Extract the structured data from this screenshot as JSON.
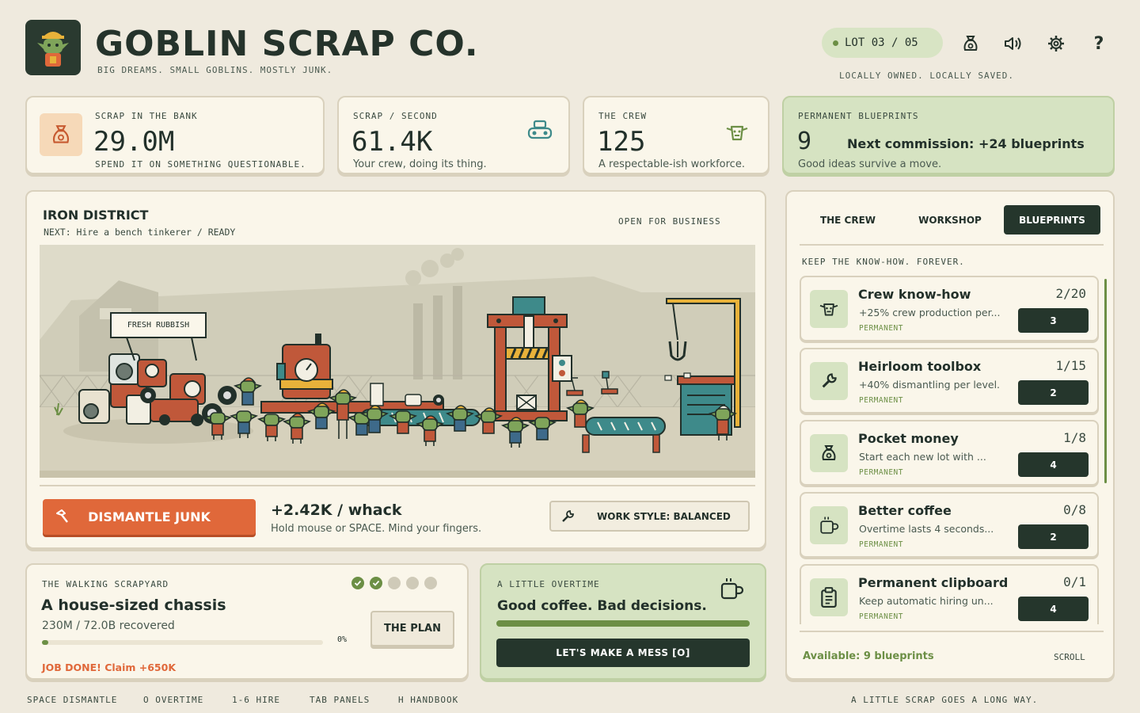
{
  "header": {
    "title": "GOBLIN SCRAP CO.",
    "subtitle": "BIG DREAMS. SMALL GOBLINS. MOSTLY JUNK.",
    "lot": "LOT 03 / 05",
    "owned": "LOCALLY OWNED. LOCALLY SAVED.",
    "help_label": "?",
    "icons": [
      "scrap-bag-icon",
      "speaker-icon",
      "gear-icon",
      "help-icon"
    ]
  },
  "stats": {
    "bank": {
      "label": "SCRAP IN THE BANK",
      "value": "29.0M",
      "note": "SPEND IT ON SOMETHING QUESTIONABLE."
    },
    "rate": {
      "label": "SCRAP / SECOND",
      "value": "61.4K",
      "note": "Your crew, doing its thing."
    },
    "crew": {
      "label": "THE CREW",
      "value": "125",
      "note": "A respectable-ish workforce."
    },
    "blueprints": {
      "label": "PERMANENT BLUEPRINTS",
      "value": "9",
      "next": "Next commission: +24 blueprints",
      "note": "Good ideas survive a move."
    }
  },
  "district": {
    "title": "IRON DISTRICT",
    "next": "NEXT: Hire a bench tinkerer  /  READY",
    "status": "OPEN FOR BUSINESS",
    "sign": "FRESH RUBBISH",
    "dismantle_label": "DISMANTLE JUNK",
    "whack": "+2.42K / whack",
    "whack_hint": "Hold mouse or SPACE. Mind your fingers.",
    "work_style": "WORK STYLE: BALANCED"
  },
  "walking": {
    "label": "THE WALKING SCRAPYARD",
    "title": "A house-sized chassis",
    "progress_text": "230M / 72.0B recovered",
    "progress_pct_label": "0%",
    "progress": 0.003,
    "steps_done": 2,
    "steps_total": 5,
    "plan_label": "THE PLAN",
    "claim": "JOB DONE! Claim +650K"
  },
  "overtime": {
    "label": "A LITTLE OVERTIME",
    "title": "Good coffee. Bad decisions.",
    "bar_fill": 1.0,
    "button": "LET'S MAKE A MESS  [O]"
  },
  "panel": {
    "tabs": [
      "THE CREW",
      "WORKSHOP",
      "BLUEPRINTS"
    ],
    "active_tab": "BLUEPRINTS",
    "tagline": "KEEP THE KNOW-HOW. FOREVER.",
    "items": [
      {
        "name": "Crew know-how",
        "desc": "+25% crew production per...",
        "tag": "PERMANENT",
        "level": "2/20",
        "cost": "3",
        "icon": "goblin-face-icon"
      },
      {
        "name": "Heirloom toolbox",
        "desc": "+40% dismantling per level.",
        "tag": "PERMANENT",
        "level": "1/15",
        "cost": "2",
        "icon": "wrench-icon"
      },
      {
        "name": "Pocket money",
        "desc": "Start each new lot with ...",
        "tag": "PERMANENT",
        "level": "1/8",
        "cost": "4",
        "icon": "money-bag-icon"
      },
      {
        "name": "Better coffee",
        "desc": "Overtime lasts 4 seconds...",
        "tag": "PERMANENT",
        "level": "0/8",
        "cost": "2",
        "icon": "coffee-icon"
      },
      {
        "name": "Permanent clipboard",
        "desc": "Keep automatic hiring un...",
        "tag": "PERMANENT",
        "level": "0/1",
        "cost": "4",
        "icon": "clipboard-icon"
      }
    ],
    "available": "Available: 9 blueprints",
    "scroll": "SCROLL"
  },
  "footer": {
    "shortcuts": [
      "SPACE  DISMANTLE",
      "O  OVERTIME",
      "1-6  HIRE",
      "TAB  PANELS",
      "H  HANDBOOK"
    ],
    "tagline": "A LITTLE SCRAP GOES A LONG WAY."
  },
  "colors": {
    "accent": "#e0683a",
    "dark": "#25362c",
    "green": "#6c8f45",
    "paper": "#faf6ea",
    "bg": "#efeade"
  }
}
